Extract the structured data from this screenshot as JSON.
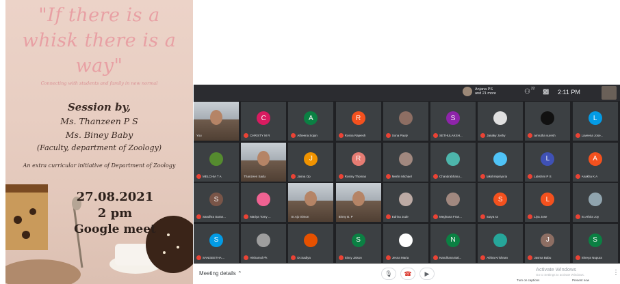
{
  "poster": {
    "tagline_1": "\"If there is a",
    "tagline_2": "whisk there is a",
    "tagline_3": "way\"",
    "subtitle": "Connecting with students and family in new normal",
    "session_by": "Session by,",
    "speaker_1": "Ms. Thanzeen P S",
    "speaker_2": "Ms. Biney Baby",
    "faculty": "(Faculty, department of Zoology)",
    "initiative": "An extra curricular initiative of Department of Zoology",
    "date": "27.08.2021",
    "time": "2 pm",
    "platform": "Google meet"
  },
  "meet": {
    "presenter_line1": "Anjana PS",
    "presenter_line2": "and 21 more",
    "participants_badge": "22",
    "clock": "2:11 PM",
    "self_label": "You",
    "meeting_details": "Meeting details",
    "activate_windows": "Activate Windows",
    "activate_sub": "Go to Settings to activate Windows.",
    "captions_label": "Turn on captions",
    "present_label": "Present now",
    "colors": {
      "muted": "#ea4335",
      "grid_bg": "#202124",
      "tile_bg": "#3c4043",
      "end_call": "#d93025"
    },
    "tiles": [
      {
        "name": "You",
        "kind": "video",
        "initial": ""
      },
      {
        "name": "CHRISTY M R",
        "kind": "letter",
        "initial": "C",
        "color": "#d81b60"
      },
      {
        "name": "Atheena Sojan",
        "kind": "letter",
        "initial": "A",
        "color": "#0b8043"
      },
      {
        "name": "Rosna Rajeesh",
        "kind": "letter",
        "initial": "R",
        "color": "#f4511e"
      },
      {
        "name": "Sona Pauly",
        "kind": "photo",
        "initial": "",
        "color": "#8d6e63"
      },
      {
        "name": "SETHULAKSH...",
        "kind": "letter",
        "initial": "S",
        "color": "#8e24aa"
      },
      {
        "name": "Janaky Joshy",
        "kind": "photo",
        "initial": "",
        "color": "#e0e0e0"
      },
      {
        "name": "amrutha suresh",
        "kind": "photo",
        "initial": "",
        "color": "#111111"
      },
      {
        "name": "Laveena Jose...",
        "kind": "letter",
        "initial": "L",
        "color": "#039be5"
      },
      {
        "name": "MELCHIA T A",
        "kind": "photo",
        "initial": "",
        "color": "#558b2f"
      },
      {
        "name": "Thanzeen Sadu",
        "kind": "video",
        "initial": ""
      },
      {
        "name": "Jasna Op",
        "kind": "letter",
        "initial": "J",
        "color": "#f09300"
      },
      {
        "name": "Rosmy Thomas",
        "kind": "letter",
        "initial": "R",
        "color": "#e67c73"
      },
      {
        "name": "Merlin Michael",
        "kind": "photo",
        "initial": "",
        "color": "#a1887f"
      },
      {
        "name": "Chandrabhanu...",
        "kind": "photo",
        "initial": "",
        "color": "#4db6ac"
      },
      {
        "name": "lakshmipriya la",
        "kind": "photo",
        "initial": "",
        "color": "#4fc3f7"
      },
      {
        "name": "Lakshmi P S",
        "kind": "letter",
        "initial": "L",
        "color": "#3f51b5"
      },
      {
        "name": "Anakha K A",
        "kind": "letter",
        "initial": "A",
        "color": "#f4511e"
      },
      {
        "name": "Sandhra Saran...",
        "kind": "letter",
        "initial": "S",
        "color": "#795548"
      },
      {
        "name": "Mariya Tomy ...",
        "kind": "photo",
        "initial": "",
        "color": "#f06292"
      },
      {
        "name": "Sr.Ajo Simon",
        "kind": "video",
        "initial": ""
      },
      {
        "name": "Binny B. P",
        "kind": "video",
        "initial": ""
      },
      {
        "name": "Edrina Jude",
        "kind": "photo",
        "initial": "",
        "color": "#bcaaa4"
      },
      {
        "name": "Meghana Fran...",
        "kind": "photo",
        "initial": "",
        "color": "#a1887f"
      },
      {
        "name": "surya ss",
        "kind": "letter",
        "initial": "S",
        "color": "#f4511e"
      },
      {
        "name": "Liya Jose",
        "kind": "letter",
        "initial": "L",
        "color": "#f4511e"
      },
      {
        "name": "Sr.Athira Joy",
        "kind": "photo",
        "initial": "",
        "color": "#90a4ae"
      },
      {
        "name": "SANGEETHA ...",
        "kind": "letter",
        "initial": "S",
        "color": "#039be5"
      },
      {
        "name": "Hishamol Pk",
        "kind": "photo",
        "initial": "",
        "color": "#9e9e9e"
      },
      {
        "name": "Dr.Sadiya",
        "kind": "photo",
        "initial": "",
        "color": "#e65100"
      },
      {
        "name": "Sincy Jaison",
        "kind": "letter",
        "initial": "S",
        "color": "#0b8043"
      },
      {
        "name": "Jesna Maria",
        "kind": "photo",
        "initial": "",
        "color": "#ffffff"
      },
      {
        "name": "Nandhana Bal...",
        "kind": "letter",
        "initial": "N",
        "color": "#0b8043"
      },
      {
        "name": "Athira Krishnan",
        "kind": "photo",
        "initial": "",
        "color": "#26a69a"
      },
      {
        "name": "Jasma Babu",
        "kind": "letter",
        "initial": "J",
        "color": "#8d6e63"
      },
      {
        "name": "Shreya Nupura",
        "kind": "letter",
        "initial": "S",
        "color": "#0b8043"
      }
    ]
  }
}
